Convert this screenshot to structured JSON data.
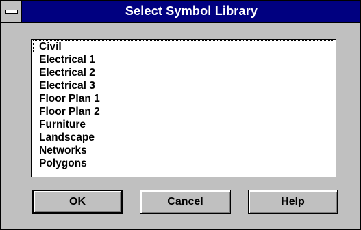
{
  "window": {
    "title": "Select Symbol Library"
  },
  "list": {
    "items": [
      "Civil",
      "Electrical 1",
      "Electrical 2",
      "Electrical 3",
      "Floor Plan 1",
      "Floor Plan 2",
      "Furniture",
      "Landscape",
      "Networks",
      "Polygons"
    ],
    "focused_item": "Civil"
  },
  "buttons": {
    "ok": "OK",
    "cancel": "Cancel",
    "help": "Help"
  },
  "icons": {
    "system_menu": "system-menu-icon"
  },
  "colors": {
    "titlebar": "#000080",
    "face": "#c0c0c0",
    "list_background": "#ffffff"
  }
}
